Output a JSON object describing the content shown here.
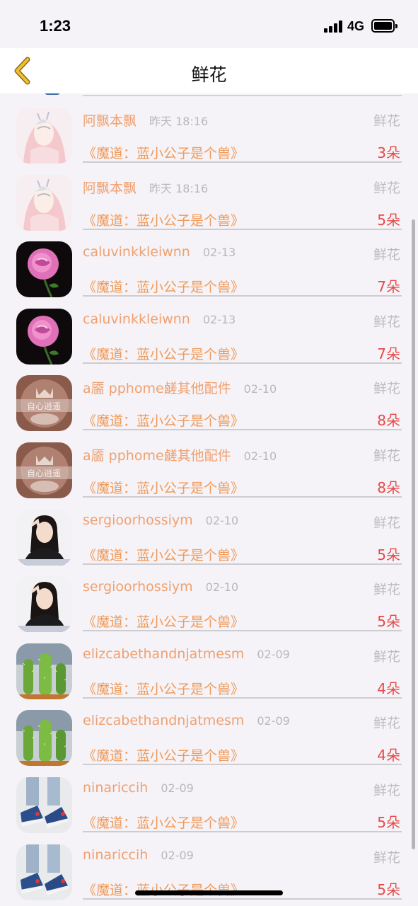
{
  "status_bar": {
    "time": "1:23",
    "network": "4G"
  },
  "nav": {
    "title": "鲜花"
  },
  "rows": [
    {
      "avatar": "girl-mask-avatar",
      "name": "阿飘本飘",
      "time": "昨天 18:16",
      "type": "鲜花",
      "book": "《魔道：蓝小公子是个兽》",
      "count": "3朵"
    },
    {
      "avatar": "girl-mask-avatar",
      "name": "阿飘本飘",
      "time": "昨天 18:16",
      "type": "鲜花",
      "book": "《魔道：蓝小公子是个兽》",
      "count": "5朵"
    },
    {
      "avatar": "rose-avatar",
      "name": "caluvinkkleiwnn",
      "time": "02-13",
      "type": "鲜花",
      "book": "《魔道：蓝小公子是个兽》",
      "count": "7朵"
    },
    {
      "avatar": "rose-avatar",
      "name": "caluvinkkleiwnn",
      "time": "02-13",
      "type": "鲜花",
      "book": "《魔道：蓝小公子是个兽》",
      "count": "7朵"
    },
    {
      "avatar": "crown-avatar",
      "name": "a靥 pphome鹾其他配件",
      "time": "02-10",
      "type": "鲜花",
      "book": "《魔道：蓝小公子是个兽》",
      "count": "8朵"
    },
    {
      "avatar": "crown-avatar",
      "name": "a靥 pphome鹾其他配件",
      "time": "02-10",
      "type": "鲜花",
      "book": "《魔道：蓝小公子是个兽》",
      "count": "8朵"
    },
    {
      "avatar": "girl-photo-avatar",
      "name": "sergioorhossiym",
      "time": "02-10",
      "type": "鲜花",
      "book": "《魔道：蓝小公子是个兽》",
      "count": "5朵"
    },
    {
      "avatar": "girl-photo-avatar",
      "name": "sergioorhossiym",
      "time": "02-10",
      "type": "鲜花",
      "book": "《魔道：蓝小公子是个兽》",
      "count": "5朵"
    },
    {
      "avatar": "cactus-avatar",
      "name": "elizcabethandnjatmesm",
      "time": "02-09",
      "type": "鲜花",
      "book": "《魔道：蓝小公子是个兽》",
      "count": "4朵"
    },
    {
      "avatar": "cactus-avatar",
      "name": "elizcabethandnjatmesm",
      "time": "02-09",
      "type": "鲜花",
      "book": "《魔道：蓝小公子是个兽》",
      "count": "4朵"
    },
    {
      "avatar": "sneakers-avatar",
      "name": "ninariccih",
      "time": "02-09",
      "type": "鲜花",
      "book": "《魔道：蓝小公子是个兽》",
      "count": "5朵"
    },
    {
      "avatar": "sneakers-avatar",
      "name": "ninariccih",
      "time": "02-09",
      "type": "鲜花",
      "book": "《魔道：蓝小公子是个兽》",
      "count": "5朵"
    }
  ],
  "colors": {
    "name": "#f0a070",
    "book": "#f09a5a",
    "count": "#e84848",
    "muted": "#b8b8bc",
    "back_arrow": "#e8b830"
  }
}
